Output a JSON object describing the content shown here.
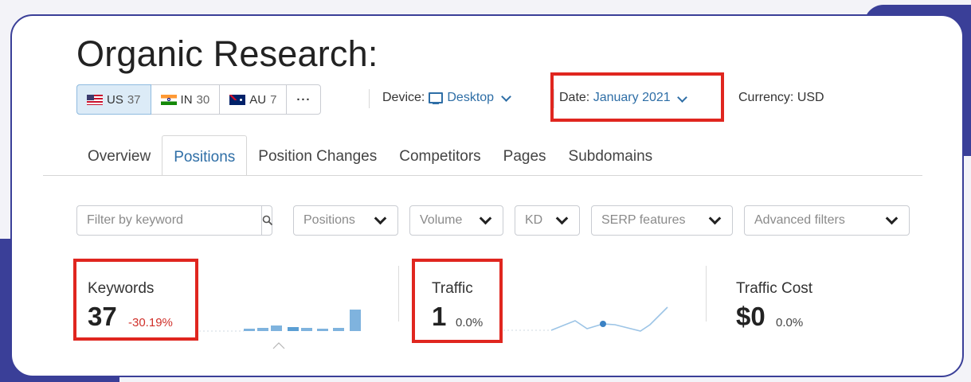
{
  "title": "Organic Research:",
  "countries": [
    {
      "code": "US",
      "count": "37",
      "active": true
    },
    {
      "code": "IN",
      "count": "30",
      "active": false
    },
    {
      "code": "AU",
      "count": "7",
      "active": false
    }
  ],
  "more_label": "···",
  "device": {
    "label": "Device:",
    "value": "Desktop"
  },
  "date": {
    "label": "Date:",
    "value": "January 2021"
  },
  "currency": {
    "label": "Currency:",
    "value": "USD"
  },
  "tabs": [
    {
      "label": "Overview",
      "active": false
    },
    {
      "label": "Positions",
      "active": true
    },
    {
      "label": "Position Changes",
      "active": false
    },
    {
      "label": "Competitors",
      "active": false
    },
    {
      "label": "Pages",
      "active": false
    },
    {
      "label": "Subdomains",
      "active": false
    }
  ],
  "filters": {
    "keyword_placeholder": "Filter by keyword",
    "positions": "Positions",
    "volume": "Volume",
    "kd": "KD",
    "serp": "SERP features",
    "advanced": "Advanced filters"
  },
  "stats": {
    "keywords": {
      "label": "Keywords",
      "value": "37",
      "delta": "-30.19%",
      "delta_color": "#d0302a"
    },
    "traffic": {
      "label": "Traffic",
      "value": "1",
      "delta": "0.0%"
    },
    "traffic_cost": {
      "label": "Traffic Cost",
      "value": "$0",
      "delta": "0.0%"
    }
  },
  "colors": {
    "accent": "#2e6ea6",
    "highlight": "#e0261f",
    "frame": "#3a3f98"
  }
}
